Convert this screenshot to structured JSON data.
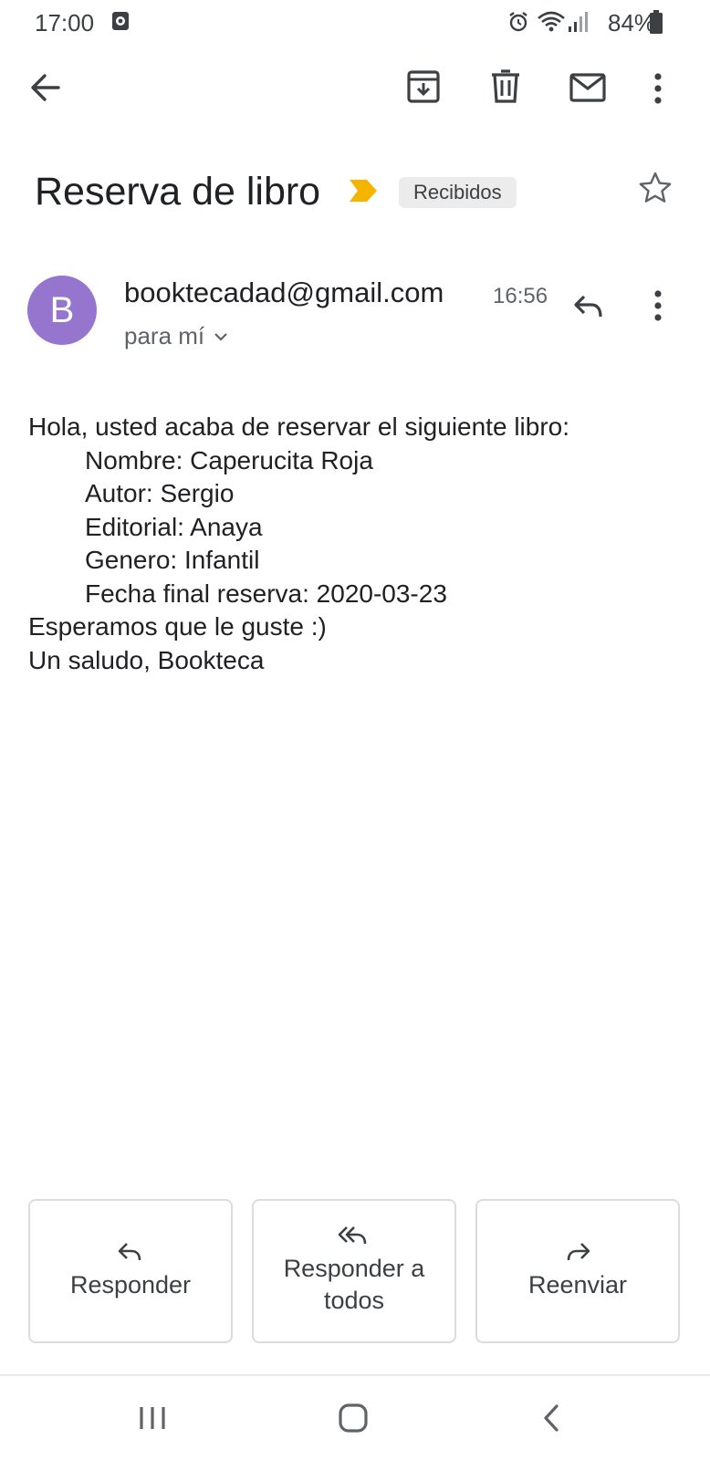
{
  "status_bar": {
    "time": "17:00",
    "battery": "84%",
    "icons": [
      "screen-record-icon",
      "alarm-icon",
      "wifi-icon",
      "signal-icon",
      "battery-icon"
    ]
  },
  "toolbar": {
    "icons": [
      "back-arrow-icon",
      "archive-icon",
      "delete-icon",
      "mark-unread-icon",
      "more-vert-icon"
    ]
  },
  "email": {
    "subject": "Reserva de libro",
    "label": "Recibidos",
    "importance_color": "#f4b400",
    "sender_initial": "B",
    "avatar_color": "#9575cd",
    "sender": "booktecadad@gmail.com",
    "time": "16:56",
    "recipient": "para mí",
    "body": {
      "greeting": "Hola, usted acaba de reservar el siguiente libro:",
      "details": [
        "Nombre: Caperucita Roja",
        "Autor: Sergio",
        "Editorial: Anaya",
        "Genero: Infantil",
        "Fecha final reserva: 2020-03-23"
      ],
      "closing": "Esperamos que le guste :)",
      "signature": "Un saludo, Bookteca"
    }
  },
  "actions": {
    "reply": "Responder",
    "reply_all_line1": "Responder a",
    "reply_all_line2": "todos",
    "forward": "Reenviar"
  },
  "nav_bar": {
    "icons": [
      "recent-apps-icon",
      "home-icon",
      "back-icon"
    ]
  }
}
